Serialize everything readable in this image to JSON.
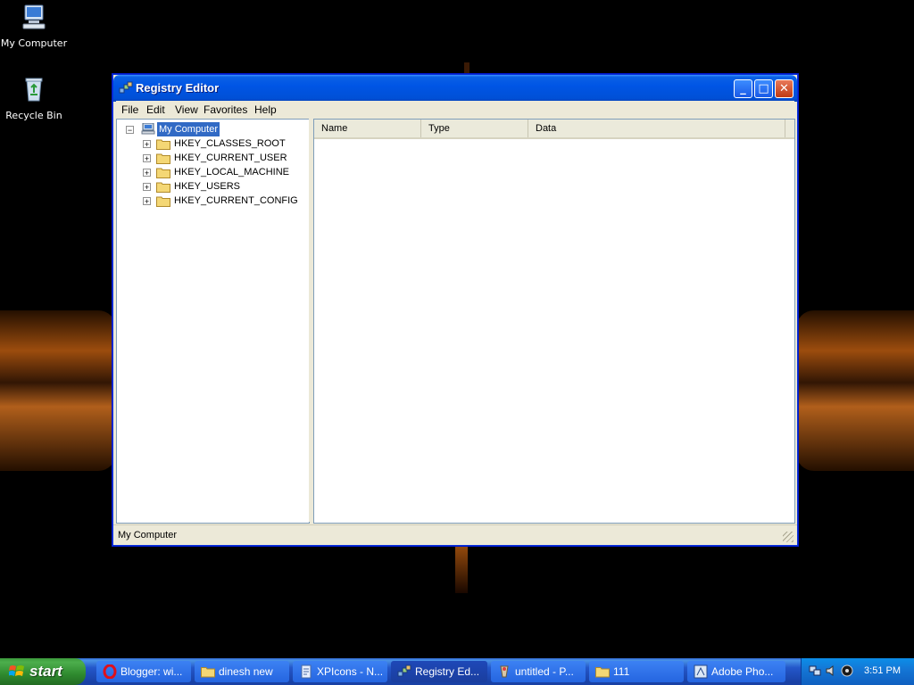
{
  "desktop": {
    "icons": [
      {
        "label": "My Computer"
      },
      {
        "label": "Recycle Bin"
      }
    ]
  },
  "window": {
    "title": "Registry Editor",
    "buttons": {
      "minimize": "_",
      "maximize": "□",
      "close": "✕"
    },
    "menu": [
      "File",
      "Edit",
      "View",
      "Favorites",
      "Help"
    ],
    "tree": {
      "root": "My Computer",
      "root_expander": "−",
      "expander": "+",
      "keys": [
        "HKEY_CLASSES_ROOT",
        "HKEY_CURRENT_USER",
        "HKEY_LOCAL_MACHINE",
        "HKEY_USERS",
        "HKEY_CURRENT_CONFIG"
      ]
    },
    "list_columns": [
      "Name",
      "Type",
      "Data"
    ],
    "status": "My Computer"
  },
  "taskbar": {
    "start_label": "start",
    "tasks": [
      {
        "label": "Blogger: wi...",
        "icon": "opera-icon"
      },
      {
        "label": "dinesh new",
        "icon": "folder-icon"
      },
      {
        "label": "XPIcons - N...",
        "icon": "notepad-icon"
      },
      {
        "label": "Registry Ed...",
        "icon": "regedit-icon",
        "active": true
      },
      {
        "label": "untitled - P...",
        "icon": "paint-icon"
      },
      {
        "label": "111",
        "icon": "folder-icon"
      },
      {
        "label": "Adobe Pho...",
        "icon": "photoshop-icon"
      }
    ],
    "clock": "3:51 PM"
  },
  "colors": {
    "title_blue": "#0055e5",
    "selection": "#316ac5",
    "start_green": "#2f8a2f",
    "taskbar_blue": "#2457ca"
  }
}
